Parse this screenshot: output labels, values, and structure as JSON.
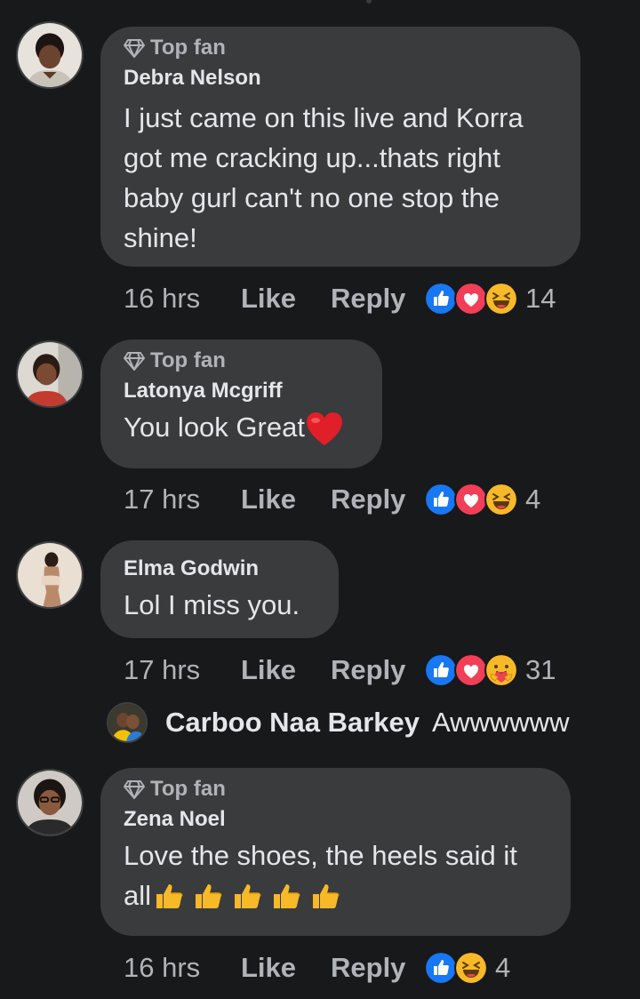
{
  "comments": [
    {
      "badge": "Top fan",
      "author": "Debra Nelson",
      "lines": [
        "I just came on this live and Korra",
        "got me cracking up...thats right",
        "baby gurl can't no one stop the",
        "shine!"
      ],
      "time": "16 hrs",
      "like": "Like",
      "reply": "Reply",
      "reactions": [
        "like-icon",
        "love-icon",
        "haha-icon"
      ],
      "count": "14"
    },
    {
      "badge": "Top fan",
      "author": "Latonya Mcgriff",
      "lines": [
        "You look Great"
      ],
      "time": "17 hrs",
      "like": "Like",
      "reply": "Reply",
      "reactions": [
        "like-icon",
        "love-icon",
        "haha-icon"
      ],
      "count": "4"
    },
    {
      "author": "Elma Godwin",
      "lines": [
        "Lol I miss you."
      ],
      "time": "17 hrs",
      "like": "Like",
      "reply": "Reply",
      "reactions": [
        "like-icon",
        "love-icon",
        "care-icon"
      ],
      "count": "31"
    },
    {
      "badge": "Top fan",
      "author": "Zena Noel",
      "lines": [
        "Love the shoes, the heels said it",
        "all"
      ],
      "time": "16 hrs",
      "like": "Like",
      "reply": "Reply",
      "reactions": [
        "like-icon",
        "haha-icon"
      ],
      "count": "4"
    }
  ],
  "nested_reply": {
    "author": "Carboo Naa Barkey",
    "text": "Awwwwww"
  },
  "colors": {
    "background": "#18191a",
    "bubble": "#3a3b3c",
    "secondary_text": "#b0b3b8",
    "like_blue": "#1877f2",
    "love_red": "#f33e58",
    "haha_yellow": "#f7b928"
  }
}
